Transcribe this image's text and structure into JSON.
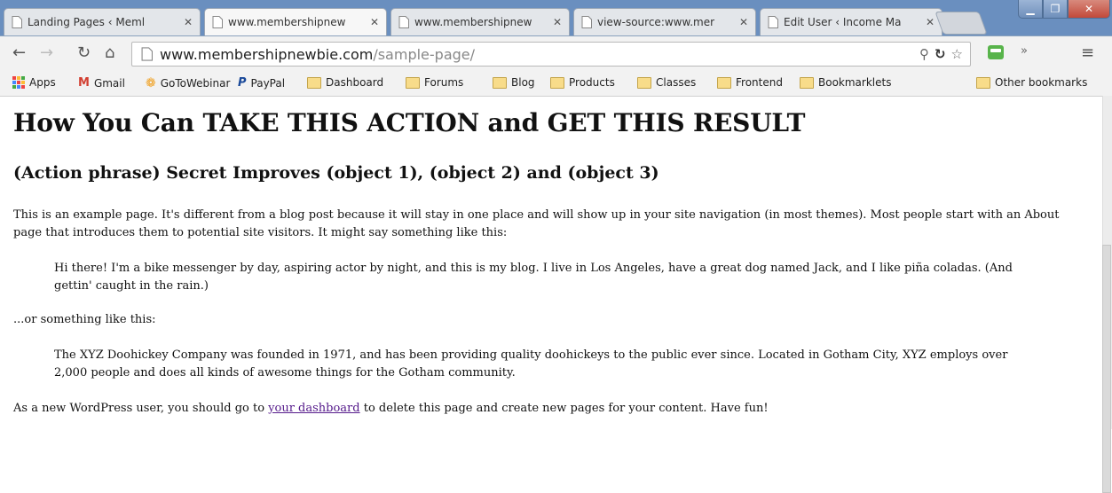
{
  "tabs": [
    {
      "title": "Landing Pages ‹ Meml"
    },
    {
      "title": "www.membershipnew",
      "active": true
    },
    {
      "title": "www.membershipnew"
    },
    {
      "title": "view-source:www.mer"
    },
    {
      "title": "Edit User ‹ Income Ma"
    }
  ],
  "address": {
    "domain": "www.membershipnewbie.com",
    "path": "/sample-page/"
  },
  "bookmarks": {
    "apps": "Apps",
    "items": [
      "Gmail",
      "GoToWebinar",
      "PayPal",
      "Dashboard",
      "Forums",
      "Blog",
      "Products",
      "Classes",
      "Frontend",
      "Bookmarklets"
    ],
    "other": "Other bookmarks"
  },
  "page": {
    "h1": "How You Can TAKE THIS ACTION and GET THIS RESULT",
    "h2": "(Action phrase) Secret Improves (object 1), (object 2) and (object 3)",
    "p1": "This is an example page. It's different from a blog post because it will stay in one place and will show up in your site navigation (in most themes). Most people start with an About page that introduces them to potential site visitors. It might say something like this:",
    "quote1": "Hi there! I'm a bike messenger by day, aspiring actor by night, and this is my blog. I live in Los Angeles, have a great dog named Jack, and I like piña coladas. (And gettin' caught in the rain.)",
    "p2": "...or something like this:",
    "quote2": "The XYZ Doohickey Company was founded in 1971, and has been providing quality doohickeys to the public ever since. Located in Gotham City, XYZ employs over 2,000 people and does all kinds of awesome things for the Gotham community.",
    "p3_before": "As a new WordPress user, you should go to ",
    "p3_link": "your dashboard",
    "p3_after": " to delete this page and create new pages for your content. Have fun!"
  },
  "colors": {
    "titlebar": "#6a8fbf",
    "link": "#551a8b"
  }
}
